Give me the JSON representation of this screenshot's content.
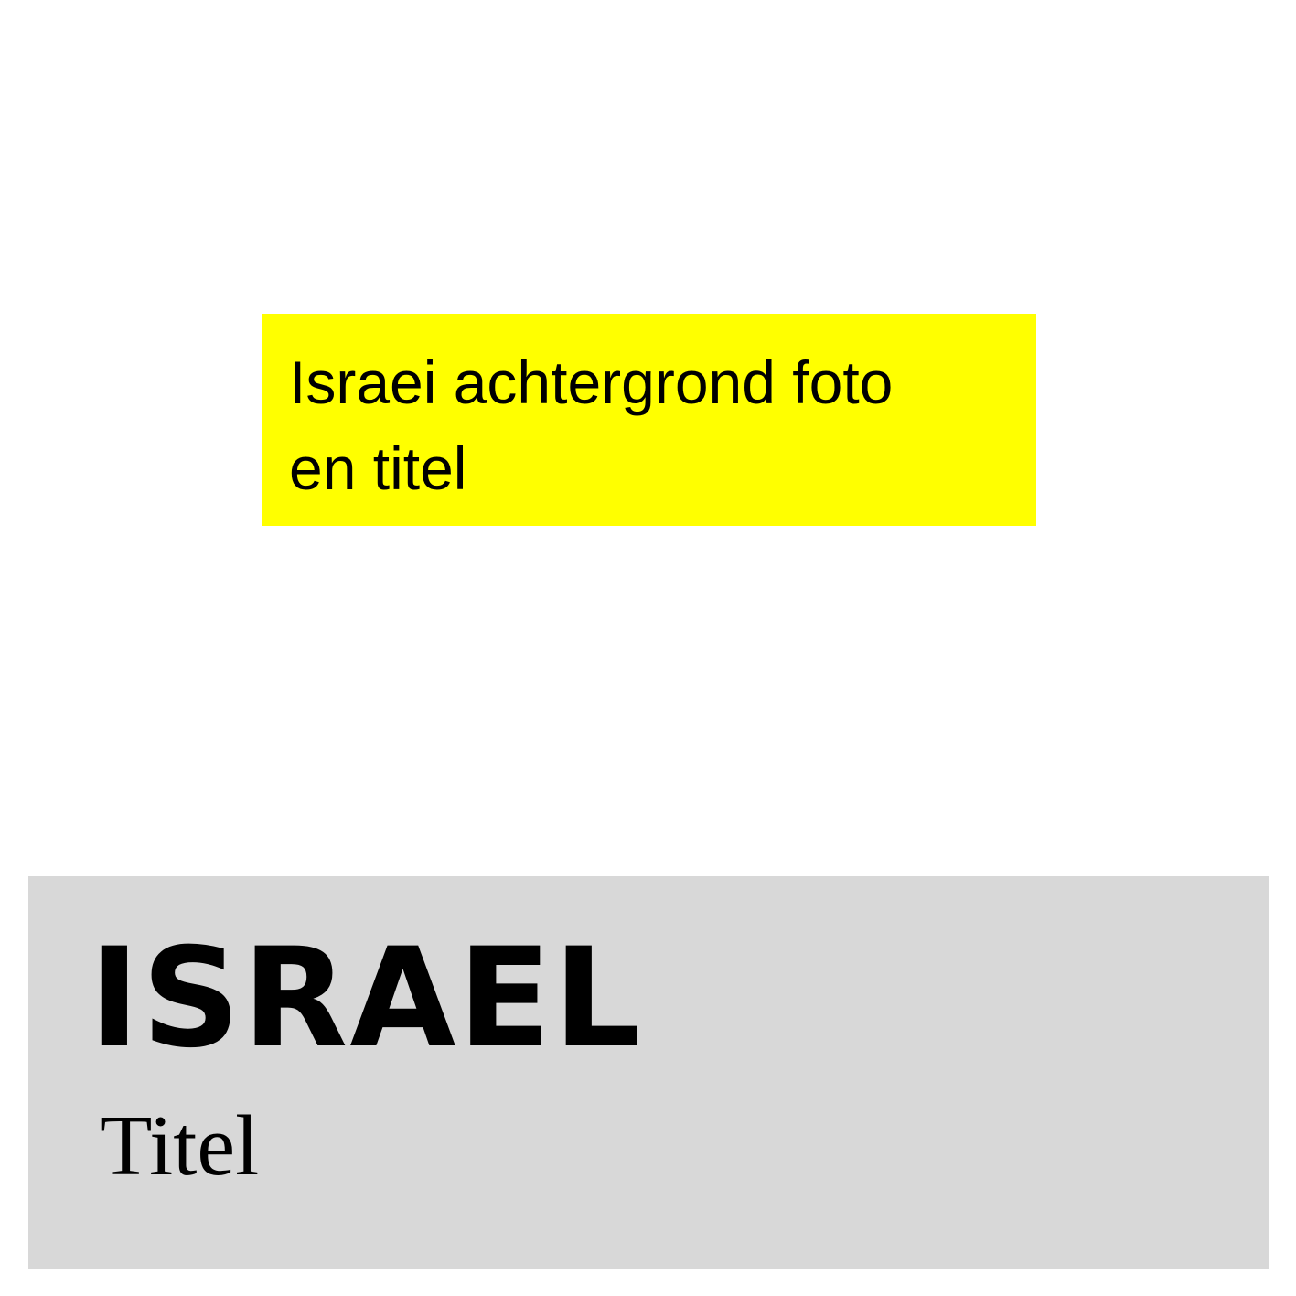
{
  "note": {
    "line1": "Israei achtergrond foto",
    "line2": "en titel",
    "background_color": "#ffff00"
  },
  "title_panel": {
    "country": "ISRAEL",
    "subtitle": "Titel",
    "background_color": "#d8d8d8"
  }
}
